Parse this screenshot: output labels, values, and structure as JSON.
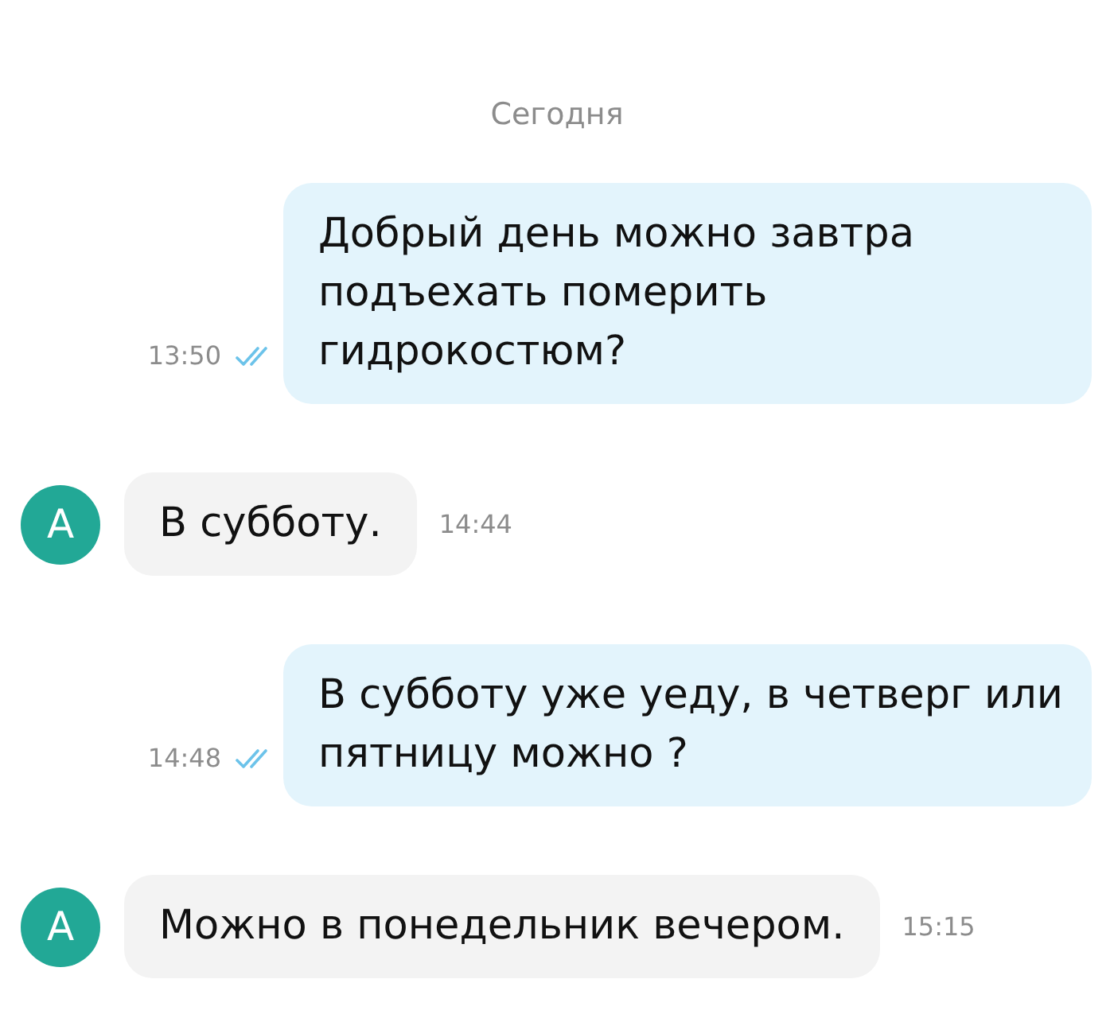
{
  "date_divider": "Сегодня",
  "messages": [
    {
      "kind": "outgoing",
      "text": "Добрый день можно завтра подъехать померить гидрокостюм?",
      "time": "13:50",
      "read": true
    },
    {
      "kind": "incoming",
      "avatar": "А",
      "text": "В субботу.",
      "time": "14:44"
    },
    {
      "kind": "outgoing",
      "text": "В субботу уже уеду, в четверг или пятницу можно ?",
      "time": "14:48",
      "read": true
    },
    {
      "kind": "incoming",
      "avatar": "А",
      "text": "Можно в понедельник вечером.",
      "time": "15:15"
    }
  ]
}
